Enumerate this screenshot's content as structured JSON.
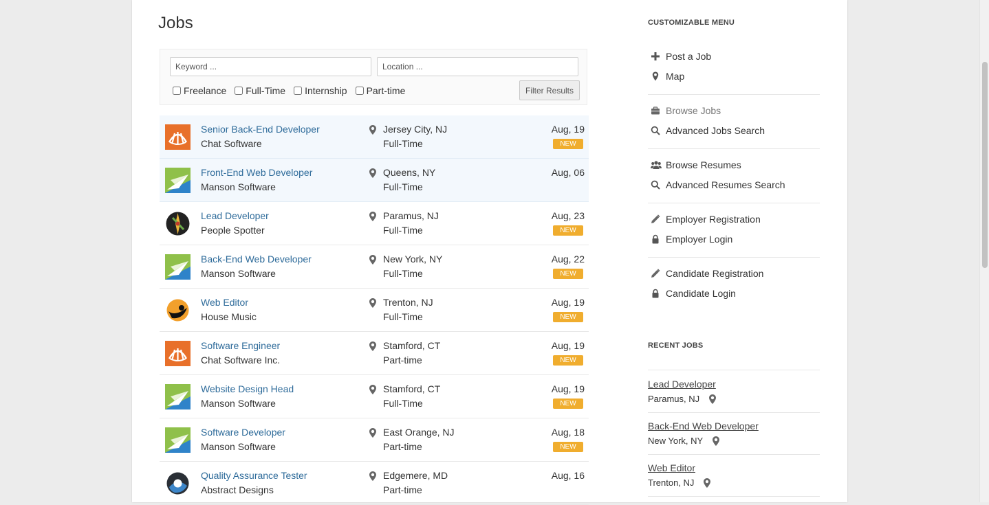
{
  "page": {
    "title": "Jobs"
  },
  "filters": {
    "keyword_placeholder": "Keyword ...",
    "location_placeholder": "Location ...",
    "checkboxes": [
      {
        "label": "Freelance",
        "checked": false
      },
      {
        "label": "Full-Time",
        "checked": false
      },
      {
        "label": "Internship",
        "checked": false
      },
      {
        "label": "Part-time",
        "checked": false
      }
    ],
    "submit_label": "Filter Results"
  },
  "jobs": [
    {
      "title": "Senior Back-End Developer",
      "company": "Chat Software",
      "location": "Jersey City, NJ",
      "type": "Full-Time",
      "date": "Aug, 19",
      "badge": "NEW",
      "featured": true,
      "logo": "chat-software-logo"
    },
    {
      "title": "Front-End Web Developer",
      "company": "Manson Software",
      "location": "Queens, NY",
      "type": "Full-Time",
      "date": "Aug, 06",
      "badge": "",
      "featured": true,
      "logo": "manson-software-logo"
    },
    {
      "title": "Lead Developer",
      "company": "People Spotter",
      "location": "Paramus, NJ",
      "type": "Full-Time",
      "date": "Aug, 23",
      "badge": "NEW",
      "featured": false,
      "logo": "people-spotter-logo"
    },
    {
      "title": "Back-End Web Developer",
      "company": "Manson Software",
      "location": "New York, NY",
      "type": "Full-Time",
      "date": "Aug, 22",
      "badge": "NEW",
      "featured": false,
      "logo": "manson-software-logo"
    },
    {
      "title": "Web Editor",
      "company": "House Music",
      "location": "Trenton, NJ",
      "type": "Full-Time",
      "date": "Aug, 19",
      "badge": "NEW",
      "featured": false,
      "logo": "house-music-logo"
    },
    {
      "title": "Software Engineer",
      "company": "Chat Software Inc.",
      "location": "Stamford, CT",
      "type": "Part-time",
      "date": "Aug, 19",
      "badge": "NEW",
      "featured": false,
      "logo": "chat-software-logo"
    },
    {
      "title": "Website Design Head",
      "company": "Manson Software",
      "location": "Stamford, CT",
      "type": "Full-Time",
      "date": "Aug, 19",
      "badge": "NEW",
      "featured": false,
      "logo": "manson-software-logo"
    },
    {
      "title": "Software Developer",
      "company": "Manson Software",
      "location": "East Orange, NJ",
      "type": "Part-time",
      "date": "Aug, 18",
      "badge": "NEW",
      "featured": false,
      "logo": "manson-software-logo"
    },
    {
      "title": "Quality Assurance Tester",
      "company": "Abstract Designs",
      "location": "Edgemere, MD",
      "type": "Part-time",
      "date": "Aug, 16",
      "badge": "",
      "featured": false,
      "logo": "abstract-designs-logo"
    }
  ],
  "sidebar": {
    "menu_heading": "CUSTOMIZABLE MENU",
    "menu_groups": [
      [
        {
          "label": "Post a Job",
          "icon": "plus-icon"
        },
        {
          "label": "Map",
          "icon": "map-pin-icon"
        }
      ],
      [
        {
          "label": "Browse Jobs",
          "icon": "briefcase-icon"
        },
        {
          "label": "Advanced Jobs Search",
          "icon": "search-icon"
        }
      ],
      [
        {
          "label": "Browse Resumes",
          "icon": "users-icon"
        },
        {
          "label": "Advanced Resumes Search",
          "icon": "search-icon"
        }
      ],
      [
        {
          "label": "Employer Registration",
          "icon": "pencil-icon"
        },
        {
          "label": "Employer Login",
          "icon": "lock-icon"
        }
      ],
      [
        {
          "label": "Candidate Registration",
          "icon": "pencil-icon"
        },
        {
          "label": "Candidate Login",
          "icon": "lock-icon"
        }
      ]
    ],
    "recent_heading": "RECENT JOBS",
    "recent_jobs": [
      {
        "title": "Lead Developer",
        "location": "Paramus, NJ"
      },
      {
        "title": "Back-End Web Developer",
        "location": "New York, NY"
      },
      {
        "title": "Web Editor",
        "location": "Trenton, NJ"
      }
    ]
  },
  "colors": {
    "link_blue": "#2e6b9a",
    "badge_orange": "#f0ad2e",
    "featured_row_bg": "#f3f8fd",
    "page_bg": "#ececec"
  }
}
